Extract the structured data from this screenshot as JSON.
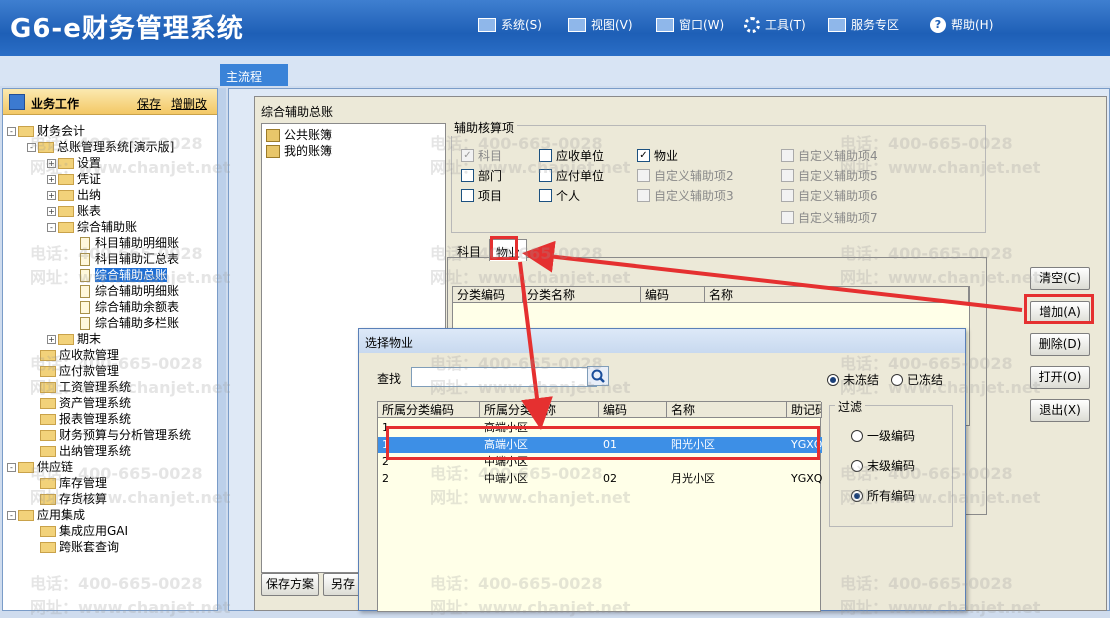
{
  "app": {
    "title": "G6-e财务管理系统"
  },
  "menubar": [
    {
      "label": "系统(S)",
      "icon": "monitor-icon"
    },
    {
      "label": "视图(V)",
      "icon": "grid-icon"
    },
    {
      "label": "窗口(W)",
      "icon": "window-icon"
    },
    {
      "label": "工具(T)",
      "icon": "gear-icon"
    },
    {
      "label": "服务专区",
      "icon": "service-icon"
    },
    {
      "label": "帮助(H)",
      "icon": "help-icon"
    }
  ],
  "tabs": {
    "main": "主流程"
  },
  "left_panel": {
    "title": "业务工作",
    "save_link": "保存",
    "add_delete_link": "增删改",
    "tree": [
      {
        "label": "财务会计",
        "level": 0,
        "expander": "-"
      },
      {
        "label": "总账管理系统[演示版]",
        "level": 1,
        "expander": "-"
      },
      {
        "label": "设置",
        "level": 2,
        "expander": "+"
      },
      {
        "label": "凭证",
        "level": 2,
        "expander": "+"
      },
      {
        "label": "出纳",
        "level": 2,
        "expander": "+"
      },
      {
        "label": "账表",
        "level": 2,
        "expander": "+"
      },
      {
        "label": "综合辅助账",
        "level": 2,
        "expander": "-"
      },
      {
        "label": "科目辅助明细账",
        "level": 3,
        "doc": true
      },
      {
        "label": "科目辅助汇总表",
        "level": 3,
        "doc": true
      },
      {
        "label": "综合辅助总账",
        "level": 3,
        "doc": true,
        "selected": true
      },
      {
        "label": "综合辅助明细账",
        "level": 3,
        "doc": true
      },
      {
        "label": "综合辅助余额表",
        "level": 3,
        "doc": true
      },
      {
        "label": "综合辅助多栏账",
        "level": 3,
        "doc": true
      },
      {
        "label": "期末",
        "level": 2,
        "expander": "+"
      },
      {
        "label": "应收款管理",
        "level": 1
      },
      {
        "label": "应付款管理",
        "level": 1
      },
      {
        "label": "工资管理系统",
        "level": 1
      },
      {
        "label": "资产管理系统",
        "level": 1
      },
      {
        "label": "报表管理系统",
        "level": 1
      },
      {
        "label": "财务预算与分析管理系统",
        "level": 1
      },
      {
        "label": "出纳管理系统",
        "level": 1
      },
      {
        "label": "供应链",
        "level": 0,
        "expander": "-"
      },
      {
        "label": "库存管理",
        "level": 1
      },
      {
        "label": "存货核算",
        "level": 1
      },
      {
        "label": "应用集成",
        "level": 0,
        "expander": "-"
      },
      {
        "label": "集成应用GAI",
        "level": 1
      },
      {
        "label": "跨账套查询",
        "level": 1
      }
    ]
  },
  "dialog1": {
    "title": "综合辅助总账",
    "books": [
      "公共账簿",
      "我的账簿"
    ],
    "group_title": "辅助核算项",
    "checkboxes": [
      {
        "label": "科目",
        "checked": true,
        "disabled": true
      },
      {
        "label": "应收单位",
        "checked": false
      },
      {
        "label": "物业",
        "checked": true
      },
      {
        "label": "自定义辅助项4",
        "checked": false,
        "disabled": true
      },
      {
        "label": "部门",
        "checked": false
      },
      {
        "label": "应付单位",
        "checked": false
      },
      {
        "label": "自定义辅助项2",
        "checked": false,
        "disabled": true
      },
      {
        "label": "自定义辅助项5",
        "checked": false,
        "disabled": true
      },
      {
        "label": "项目",
        "checked": false
      },
      {
        "label": "个人",
        "checked": false
      },
      {
        "label": "自定义辅助项3",
        "checked": false,
        "disabled": true
      },
      {
        "label": "自定义辅助项6",
        "checked": false,
        "disabled": true
      },
      {
        "label": "自定义辅助项7",
        "checked": false,
        "disabled": true
      }
    ],
    "tabs": [
      "科目",
      "物业"
    ],
    "grid_headers": [
      "分类编码",
      "分类名称",
      "编码",
      "名称"
    ],
    "buttons": {
      "clear": "清空(C)",
      "add": "增加(A)",
      "delete": "删除(D)",
      "open": "打开(O)",
      "exit": "退出(X)"
    },
    "bottom_buttons": {
      "save_plan": "保存方案",
      "save_as": "另存"
    }
  },
  "dialog2": {
    "title": "选择物业",
    "search_label": "查找",
    "search_value": "",
    "status_radios": [
      {
        "label": "未冻结",
        "selected": true
      },
      {
        "label": "已冻结",
        "selected": false
      }
    ],
    "headers": [
      "所属分类编码",
      "所属分类名称",
      "编码",
      "名称",
      "助记码"
    ],
    "rows": [
      {
        "cat_code": "1",
        "cat_name": "高端小区",
        "code": "",
        "name": "",
        "mnemonic": "",
        "highlight": false
      },
      {
        "cat_code": "1",
        "cat_name": "高端小区",
        "code": "01",
        "name": "阳光小区",
        "mnemonic": "YGXQ",
        "highlight": true
      },
      {
        "cat_code": "2",
        "cat_name": "中端小区",
        "code": "",
        "name": "",
        "mnemonic": "",
        "highlight": false
      },
      {
        "cat_code": "2",
        "cat_name": "中端小区",
        "code": "02",
        "name": "月光小区",
        "mnemonic": "YGXQ",
        "highlight": false
      }
    ],
    "filter_title": "过滤",
    "filter_options": [
      {
        "label": "一级编码",
        "selected": false
      },
      {
        "label": "末级编码",
        "selected": false
      },
      {
        "label": "所有编码",
        "selected": true
      }
    ]
  },
  "watermark": {
    "phone": "电话：400-665-0028",
    "site": "网址：www.chanjet.net"
  },
  "colors": {
    "highlight": "#3d8fe6",
    "annotation_red": "#e53030",
    "title_bar": "#1e5fb6"
  }
}
